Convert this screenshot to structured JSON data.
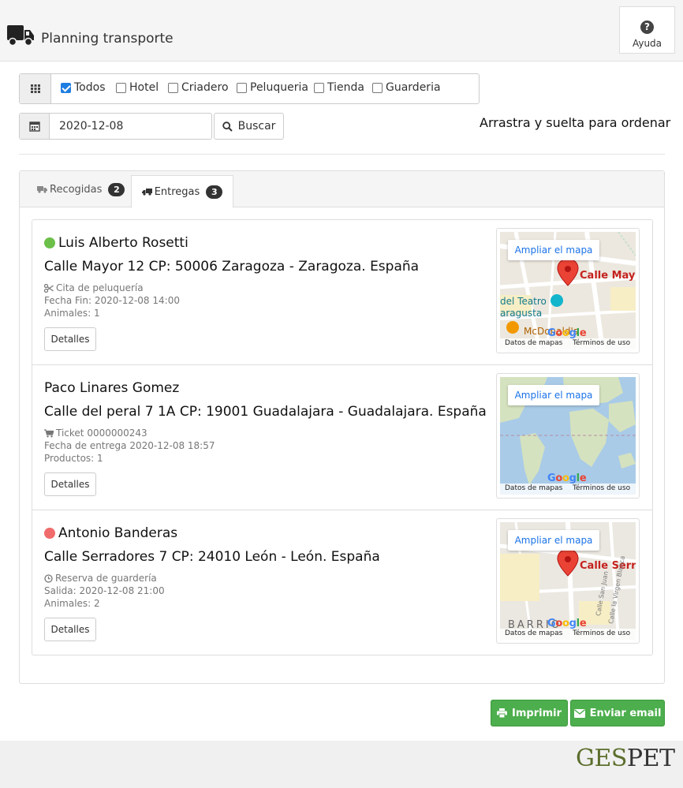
{
  "header": {
    "title": "Planning transporte",
    "help_label": "Ayuda",
    "truck_icon": "truck-icon",
    "help_icon": "question-circle-icon"
  },
  "filters": {
    "icon": "grid-icon",
    "options": [
      {
        "label": "Todos",
        "checked": true
      },
      {
        "label": "Hotel",
        "checked": false
      },
      {
        "label": "Criadero",
        "checked": false
      },
      {
        "label": "Peluqueria",
        "checked": false
      },
      {
        "label": "Tienda",
        "checked": false
      },
      {
        "label": "Guarderia",
        "checked": false
      }
    ]
  },
  "search": {
    "date_value": "2020-12-08",
    "button_label": "Buscar",
    "calendar_icon": "calendar-icon",
    "search_icon": "search-icon"
  },
  "hint": "Arrastra y suelta para ordenar",
  "tabs": [
    {
      "label": "Recogidas",
      "count": "2",
      "active": false
    },
    {
      "label": "Entregas",
      "count": "3",
      "active": true
    }
  ],
  "deliveries": [
    {
      "status_color": "#6cc04a",
      "name": "Luis Alberto Rosetti",
      "address": "Calle Mayor 12 CP: 50006 Zaragoza - Zaragoza. España",
      "meta_icon": "scissors-icon",
      "meta1": "Cita de peluquería",
      "meta2": "Fecha Fin: 2020-12-08 14:00",
      "meta3": "Animales: 1",
      "details_label": "Detalles",
      "map": {
        "button": "Ampliar el mapa",
        "pin_label": "Calle Mayor",
        "poi1": "del Teatro",
        "poi2": "aragusta",
        "poi3": "McDonald's",
        "google": "Google",
        "footer_left": "Datos de mapas",
        "footer_right": "Términos de uso"
      }
    },
    {
      "status_color": null,
      "name": "Paco Linares Gomez",
      "address": "Calle del peral 7 1A CP: 19001 Guadalajara - Guadalajara. España",
      "meta_icon": "cart-icon",
      "meta1": "Ticket 0000000243",
      "meta2": "Fecha de entrega 2020-12-08 18:57",
      "meta3": "Productos: 1",
      "details_label": "Detalles",
      "map": {
        "button": "Ampliar el mapa",
        "google": "Google",
        "footer_left": "Datos de mapas",
        "footer_right": "Términos de uso"
      }
    },
    {
      "status_color": "#f06b6b",
      "name": "Antonio Banderas",
      "address": "Calle Serradores 7 CP: 24010 León - León. España",
      "meta_icon": "clock-icon",
      "meta1": "Reserva de guardería",
      "meta2": "Salida: 2020-12-08 21:00",
      "meta3": "Animales: 2",
      "details_label": "Detalles",
      "map": {
        "button": "Ampliar el mapa",
        "pin_label": "Calle Serrad",
        "poi1": "BARRIO",
        "poi2": "Calle San Juan",
        "poi3": "Calle la Virgen Blanca",
        "google": "Google",
        "footer_left": "Datos de mapas",
        "footer_right": "Términos de uso"
      }
    }
  ],
  "actions": {
    "print_label": "Imprimir",
    "email_label": "Enviar email",
    "print_icon": "print-icon",
    "email_icon": "envelope-icon",
    "color": "#4cae4c"
  },
  "footer": {
    "logo_a": "GES",
    "logo_b": "PET"
  }
}
